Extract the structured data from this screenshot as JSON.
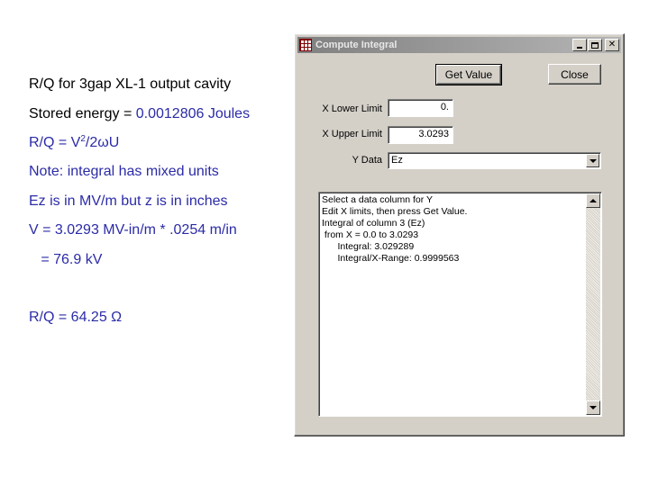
{
  "slide": {
    "title": "R/Q for 3gap XL-1 output cavity",
    "stored_energy_label": "Stored energy = ",
    "stored_energy_value": "0.0012806 Joules",
    "rq_formula_prefix": "R/Q = V",
    "rq_formula_sup": "2",
    "rq_formula_suffix": "/2ωU",
    "note": " Note: integral has mixed units",
    "units_line": "Ez is in MV/m   but z is in inches",
    "v_line": "V = 3.0293 MV-in/m * .0254 m/in",
    "kv_line": "   = 76.9 kV",
    "rq_result": "R/Q = 64.25 Ω"
  },
  "window": {
    "title": "Compute Integral",
    "get_value_label": "Get Value",
    "close_label": "Close",
    "x_lower_label": "X Lower Limit",
    "x_lower_value": "0.",
    "x_upper_label": "X Upper Limit",
    "x_upper_value": "3.0293",
    "y_data_label": "Y Data",
    "y_data_value": "Ez",
    "output_text": "Select a data column for Y\nEdit X limits, then press Get Value.\nIntegral of column 3 (Ez)\n from X = 0.0 to 3.0293\n      Integral: 3.029289\n      Integral/X-Range: 0.9999563"
  }
}
